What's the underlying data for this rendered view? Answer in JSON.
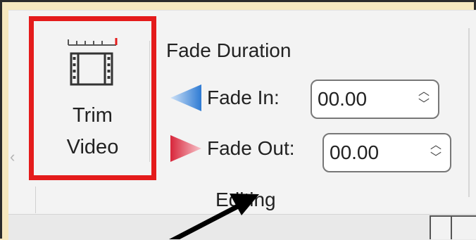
{
  "ribbon": {
    "trim_video": {
      "label_line1": "Trim",
      "label_line2": "Video",
      "icon": "film-trim-icon",
      "highlight_color": "#e41b1b"
    },
    "fade_duration": {
      "title": "Fade Duration",
      "fade_in": {
        "label": "Fade In:",
        "value": "00.00",
        "icon": "fade-in-icon",
        "icon_color": "#4a8fd8"
      },
      "fade_out": {
        "label": "Fade Out:",
        "value": "00.00",
        "icon": "fade-out-icon",
        "icon_color": "#e03b4a"
      }
    },
    "group_label": "Editing"
  },
  "annotation": {
    "arrow_color": "#000000"
  }
}
